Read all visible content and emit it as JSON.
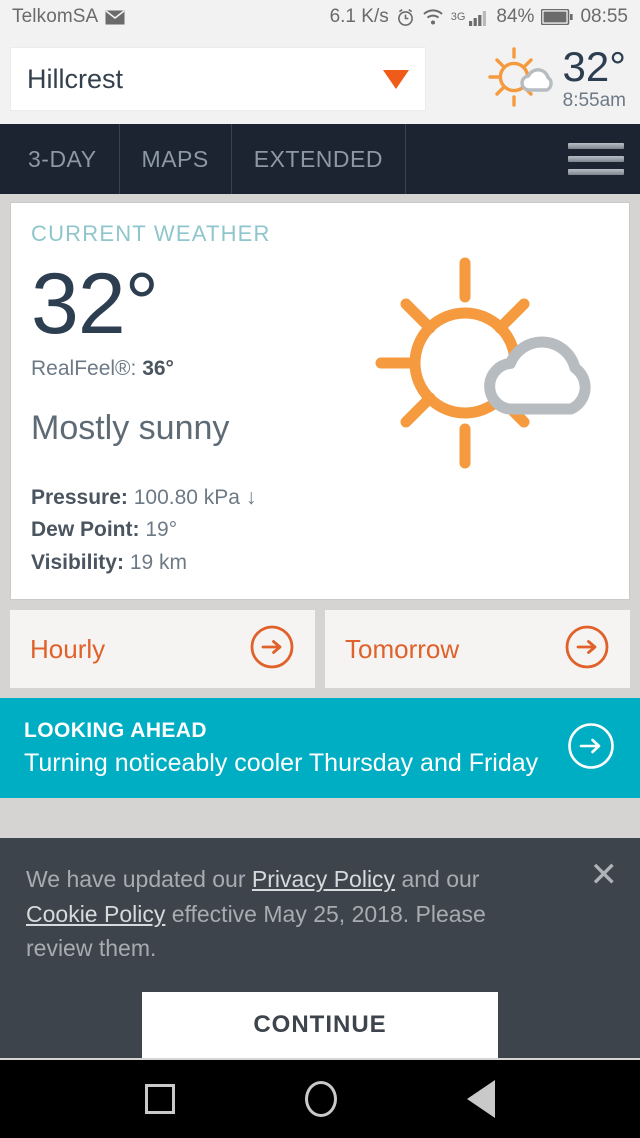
{
  "statusbar": {
    "carrier": "TelkomSA",
    "mail_icon": "mail-icon",
    "net_speed": "6.1 K/s",
    "alarm_icon": "alarm-icon",
    "wifi_icon": "wifi-icon",
    "network_type": "3G",
    "signal_icon": "signal-bars-icon",
    "battery_percent": "84%",
    "battery_icon": "battery-icon",
    "clock": "08:55"
  },
  "header": {
    "location": "Hillcrest",
    "dropdown_icon": "caret-down-icon",
    "weather_icon": "sun-behind-cloud-icon",
    "temperature": "32°",
    "observed_time": "8:55am"
  },
  "tabs": [
    {
      "label": "3-DAY"
    },
    {
      "label": "MAPS"
    },
    {
      "label": "EXTENDED"
    }
  ],
  "menu": {
    "icon": "hamburger-menu-icon"
  },
  "current": {
    "title": "CURRENT WEATHER",
    "temperature": "32°",
    "realfeel_label": "RealFeel®: ",
    "realfeel_value": "36°",
    "phrase": "Mostly sunny",
    "icon": "sun-behind-cloud-icon",
    "details": [
      {
        "label": "Pressure:",
        "value": "100.80 kPa ↓"
      },
      {
        "label": "Dew Point:",
        "value": "19°"
      },
      {
        "label": "Visibility:",
        "value": "19 km"
      }
    ]
  },
  "links": [
    {
      "label": "Hourly",
      "icon": "arrow-right-circle-icon"
    },
    {
      "label": "Tomorrow",
      "icon": "arrow-right-circle-icon"
    }
  ],
  "looking_ahead": {
    "kicker": "LOOKING AHEAD",
    "body": "Turning noticeably cooler Thursday and Friday",
    "icon": "arrow-right-circle-icon"
  },
  "cookie": {
    "text_1": "We have updated our ",
    "link_1": "Privacy Policy",
    "text_2": " and our ",
    "link_2": "Cookie Policy",
    "text_3": " effective May 25, 2018. Please review them.",
    "close_icon": "close-icon",
    "continue_label": "CONTINUE"
  },
  "navbar": {
    "recents_icon": "square-recents-icon",
    "home_icon": "circle-home-icon",
    "back_icon": "triangle-back-icon"
  },
  "colors": {
    "accent_orange": "#e0612a",
    "teal": "#00aec3",
    "dark_navy": "#1b2430",
    "slate": "#3e444c",
    "temp_navy": "#2c3e50",
    "card_title": "#8ec6cc",
    "sun_orange": "#f59a3e",
    "cloud_gray": "#b7bcc0"
  }
}
